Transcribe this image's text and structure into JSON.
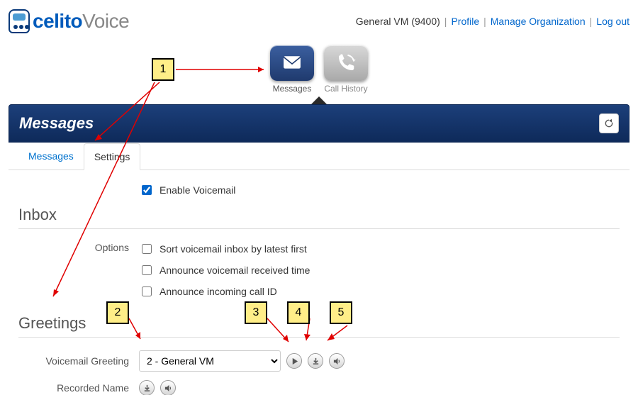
{
  "header": {
    "user_label": "General VM (9400)",
    "links": {
      "profile": "Profile",
      "manage_org": "Manage Organization",
      "logout": "Log out"
    }
  },
  "logo": {
    "brand1": "celito",
    "brand2": "Voice"
  },
  "nav": {
    "messages": "Messages",
    "call_history": "Call History"
  },
  "panel": {
    "title": "Messages"
  },
  "tabs": {
    "messages": "Messages",
    "settings": "Settings"
  },
  "settings": {
    "enable_vm": "Enable Voicemail",
    "enable_vm_checked": true,
    "inbox_title": "Inbox",
    "options_label": "Options",
    "opt_sort": "Sort voicemail inbox by latest first",
    "opt_time": "Announce voicemail received time",
    "opt_callid": "Announce incoming call ID",
    "greetings_title": "Greetings",
    "vm_greeting_label": "Voicemail Greeting",
    "vm_greeting_value": "2 - General VM",
    "recorded_name_label": "Recorded Name"
  },
  "callouts": {
    "c1": "1",
    "c2": "2",
    "c3": "3",
    "c4": "4",
    "c5": "5"
  }
}
